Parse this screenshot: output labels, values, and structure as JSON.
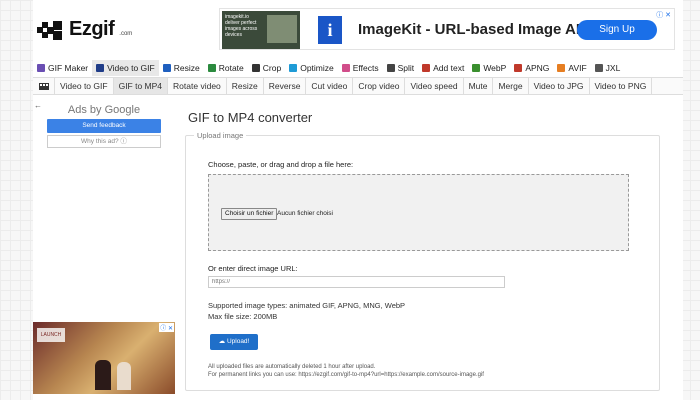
{
  "header": {
    "logo_text": "Ezgif",
    "logo_suffix": ".com"
  },
  "ad_banner": {
    "thumb_text": "imagekit.io\ndeliver perfect images across devices",
    "icon_letter": "i",
    "title": "ImageKit - URL-based Image API",
    "cta": "Sign Up",
    "close": "ⓘ ✕"
  },
  "main_nav": [
    {
      "label": "GIF Maker",
      "icon": "gif-maker-icon",
      "color": "#6a4fb3",
      "active": false
    },
    {
      "label": "Video to GIF",
      "icon": "video-icon",
      "color": "#1f3c88",
      "active": true
    },
    {
      "label": "Resize",
      "icon": "resize-icon",
      "color": "#1f5fbf",
      "active": false
    },
    {
      "label": "Rotate",
      "icon": "rotate-icon",
      "color": "#2b8a3e",
      "active": false
    },
    {
      "label": "Crop",
      "icon": "crop-icon",
      "color": "#333333",
      "active": false
    },
    {
      "label": "Optimize",
      "icon": "optimize-icon",
      "color": "#1f9bd6",
      "active": false
    },
    {
      "label": "Effects",
      "icon": "effects-icon",
      "color": "#d14d8a",
      "active": false
    },
    {
      "label": "Split",
      "icon": "split-icon",
      "color": "#444444",
      "active": false
    },
    {
      "label": "Add text",
      "icon": "text-icon",
      "color": "#c0392b",
      "active": false
    },
    {
      "label": "WebP",
      "icon": "webp-icon",
      "color": "#3a8f2e",
      "active": false
    },
    {
      "label": "APNG",
      "icon": "apng-icon",
      "color": "#c0392b",
      "active": false
    },
    {
      "label": "AVIF",
      "icon": "avif-icon",
      "color": "#e67e22",
      "active": false
    },
    {
      "label": "JXL",
      "icon": "jxl-icon",
      "color": "#555555",
      "active": false
    }
  ],
  "sub_nav": [
    {
      "label": "Video to GIF",
      "active": false
    },
    {
      "label": "GIF to MP4",
      "active": true
    },
    {
      "label": "Rotate video",
      "active": false
    },
    {
      "label": "Resize",
      "active": false
    },
    {
      "label": "Reverse",
      "active": false
    },
    {
      "label": "Cut video",
      "active": false
    },
    {
      "label": "Crop video",
      "active": false
    },
    {
      "label": "Video speed",
      "active": false
    },
    {
      "label": "Mute",
      "active": false
    },
    {
      "label": "Merge",
      "active": false
    },
    {
      "label": "Video to JPG",
      "active": false
    },
    {
      "label": "Video to PNG",
      "active": false
    }
  ],
  "sidebar": {
    "back": "←",
    "ads_by": "Ads by Google",
    "feedback": "Send feedback",
    "why_ad": "Why this ad? ⓘ",
    "ad_sign": "LAUNCH",
    "ad_close": "ⓘ ✕"
  },
  "main": {
    "title": "GIF to MP4 converter",
    "legend": "Upload image",
    "choose_label": "Choose, paste, or drag and drop a file here:",
    "file_button": "Choisir un fichier",
    "file_none": "Aucun fichier choisi",
    "url_label": "Or enter direct image URL:",
    "url_placeholder": "https://",
    "supported": "Supported image types: animated GIF, APNG, MNG, WebP",
    "max_size": "Max file size: 200MB",
    "upload_button": "Upload!",
    "note_deleted": "All uploaded files are automatically deleted 1 hour after upload.",
    "note_permanent_prefix": "For permanent links you can use: ",
    "note_permanent_link": "https://ezgif.com/gif-to-mp4?url=https://example.com/source-image.gif"
  }
}
